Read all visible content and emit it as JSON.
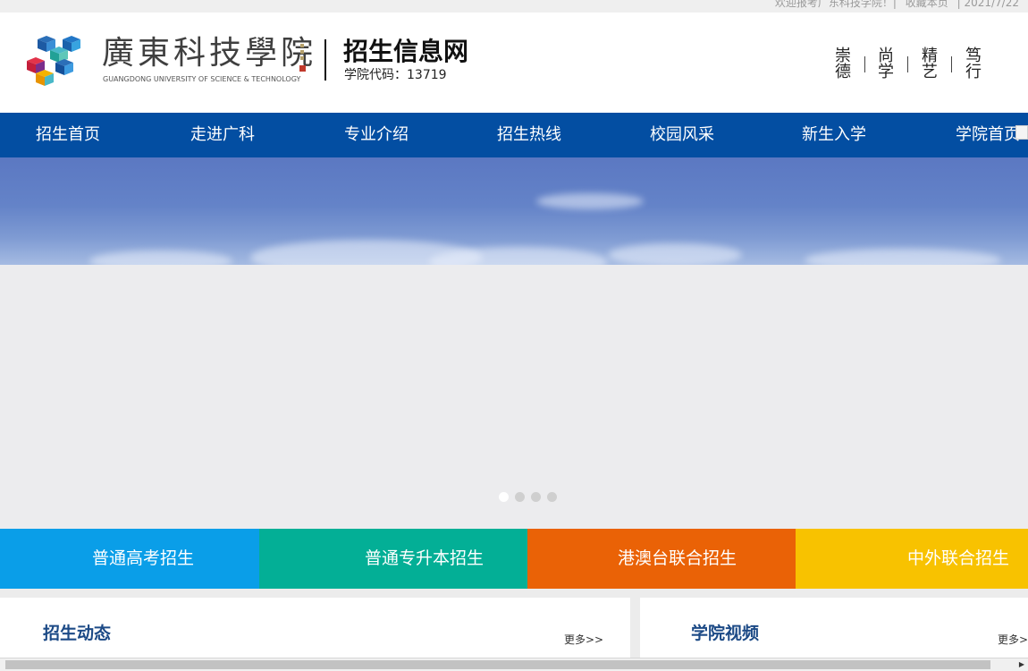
{
  "topbar": {
    "welcome": "欢迎报考广东科技学院！|",
    "bookmark": "收藏本页",
    "date": "| 2021/7/22"
  },
  "header": {
    "school_name_cn": "廣東科技學院",
    "school_name_en": "GUANGDONG UNIVERSITY OF SCIENCE & TECHNOLOGY",
    "site_title": "招生信息网",
    "school_code": "学院代码：13719",
    "motto": [
      {
        "top": "崇",
        "bottom": "德"
      },
      {
        "top": "尚",
        "bottom": "学"
      },
      {
        "top": "精",
        "bottom": "艺"
      },
      {
        "top": "笃",
        "bottom": "行"
      }
    ]
  },
  "nav": {
    "items": [
      "招生首页",
      "走进广科",
      "专业介绍",
      "招生热线",
      "校园风采",
      "新生入学",
      "学院首页"
    ]
  },
  "banner": {
    "slide_count": 4,
    "active_slide": 1
  },
  "tiles": [
    {
      "label": "普通高考招生",
      "color": "#0a9ee8"
    },
    {
      "label": "普通专升本招生",
      "color": "#03af96"
    },
    {
      "label": "港澳台联合招生",
      "color": "#ea6206"
    },
    {
      "label": "中外联合招生",
      "color": "#f8c200"
    }
  ],
  "panels": {
    "news_title": "招生动态",
    "news_more": "更多>>",
    "video_title": "学院视频",
    "video_more": "更多>>"
  },
  "colors": {
    "nav_bg": "#034ea2",
    "title_blue": "#1c4a86"
  }
}
